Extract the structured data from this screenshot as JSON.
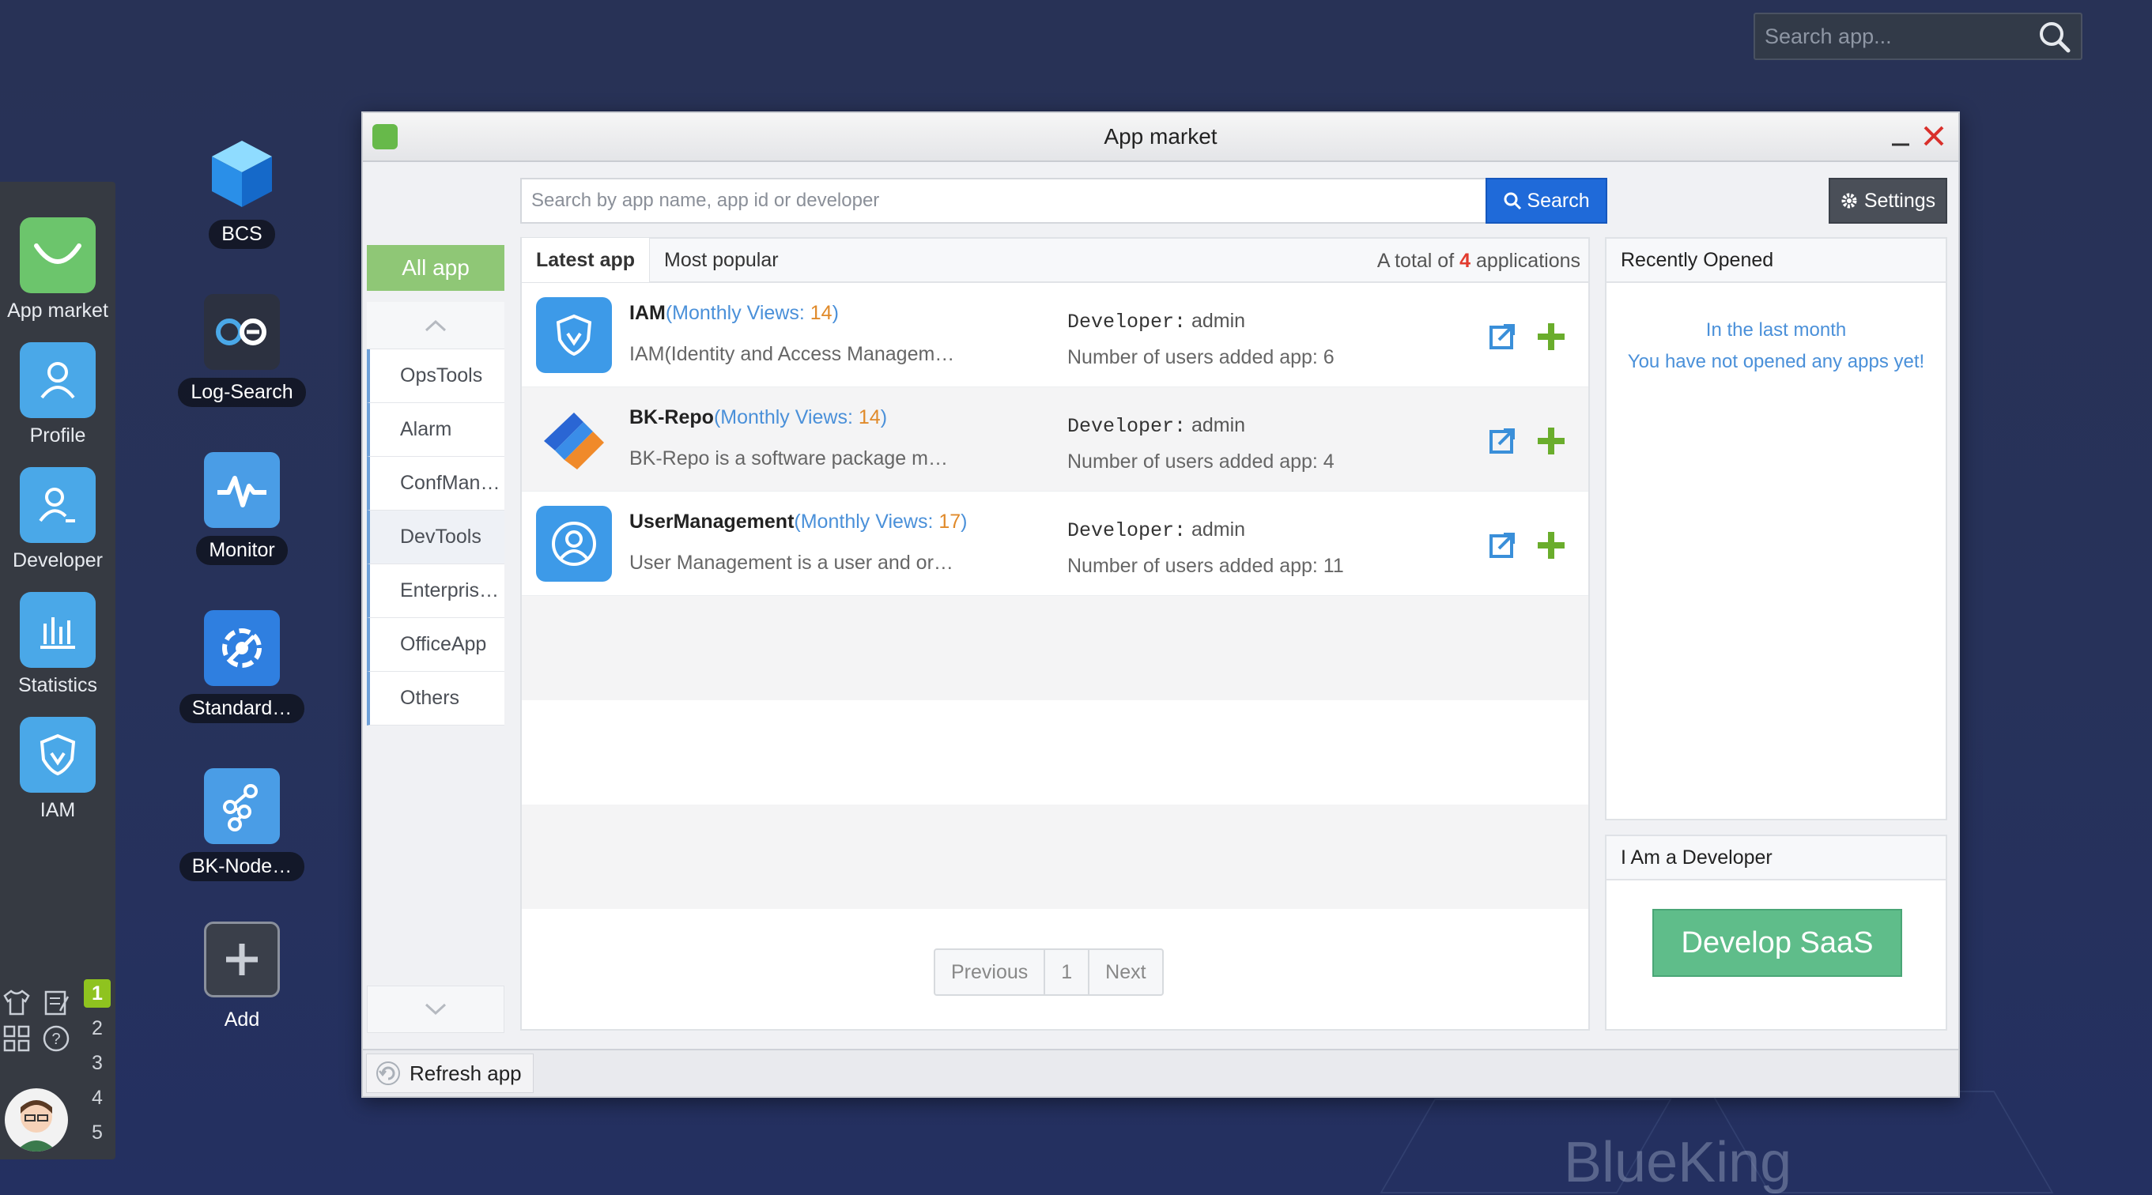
{
  "desktop": {
    "search_placeholder": "Search app...",
    "brand": "BlueKing"
  },
  "dock": {
    "items": [
      {
        "label": "App market",
        "icon": "app-market-icon"
      },
      {
        "label": "Profile",
        "icon": "profile-icon"
      },
      {
        "label": "Developer",
        "icon": "developer-icon"
      },
      {
        "label": "Statistics",
        "icon": "statistics-icon"
      },
      {
        "label": "IAM",
        "icon": "iam-shield-icon"
      }
    ],
    "workspaces": [
      "1",
      "2",
      "3",
      "4",
      "5"
    ],
    "active_workspace": "1"
  },
  "desktop_apps": [
    {
      "label": "BCS",
      "icon": "bcs-cube-icon"
    },
    {
      "label": "Log-Search",
      "icon": "log-search-icon"
    },
    {
      "label": "Monitor",
      "icon": "monitor-pulse-icon"
    },
    {
      "label": "Standard…",
      "icon": "standard-ops-icon"
    },
    {
      "label": "BK-Node…",
      "icon": "bk-node-icon"
    },
    {
      "label": "Add",
      "icon": "add-icon"
    }
  ],
  "window": {
    "title": "App market",
    "search_placeholder": "Search by app name, app id or developer",
    "search_button": "Search",
    "settings_button": "Settings",
    "refresh_label": "Refresh app"
  },
  "categories": {
    "all_label": "All app",
    "items": [
      "OpsTools",
      "Alarm",
      "ConfMan…",
      "DevTools",
      "Enterpris…",
      "OfficeApp",
      "Others"
    ],
    "active": "DevTools"
  },
  "list": {
    "tabs": [
      "Latest app",
      "Most popular"
    ],
    "total_prefix": "A total of",
    "total_count": "4",
    "total_suffix": "applications",
    "apps": [
      {
        "name": "IAM",
        "monthly_label": "Monthly Views: ",
        "monthly_views": "14",
        "desc": "IAM(Identity and Access Managem…",
        "developer_label": "Developer:",
        "developer": "admin",
        "users_text": "Number of users added app: 6"
      },
      {
        "name": "BK-Repo",
        "monthly_label": "Monthly Views: ",
        "monthly_views": "14",
        "desc": "BK-Repo is a software package m…",
        "developer_label": "Developer:",
        "developer": "admin",
        "users_text": "Number of users added app: 4"
      },
      {
        "name": "UserManagement",
        "monthly_label": "Monthly Views: ",
        "monthly_views": "17",
        "desc": "User Management is a user and or…",
        "developer_label": "Developer:",
        "developer": "admin",
        "users_text": "Number of users added app: 11"
      }
    ],
    "pager": {
      "prev": "Previous",
      "page": "1",
      "next": "Next"
    }
  },
  "recent": {
    "title": "Recently Opened",
    "line1": "In the last month",
    "line2": "You have not opened any apps yet!"
  },
  "developer_panel": {
    "title": "I Am a Developer",
    "button": "Develop SaaS"
  }
}
